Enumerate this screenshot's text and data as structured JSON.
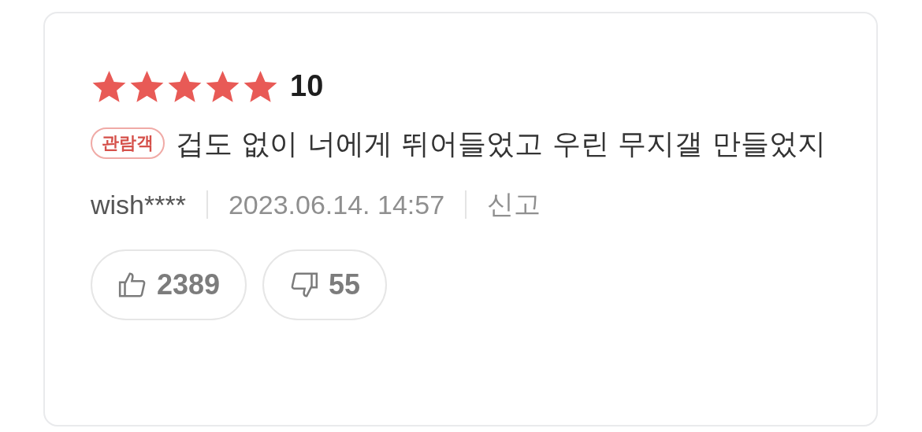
{
  "review": {
    "stars": 5,
    "score": "10",
    "badge": "관람객",
    "text": "겁도 없이 너에게 뛰어들었고 우린 무지갤 만들었지",
    "author": "wish****",
    "date": "2023.06.14. 14:57",
    "report": "신고",
    "votes": [
      {
        "kind": "like",
        "count": "2389"
      },
      {
        "kind": "dislike",
        "count": "55"
      }
    ]
  }
}
